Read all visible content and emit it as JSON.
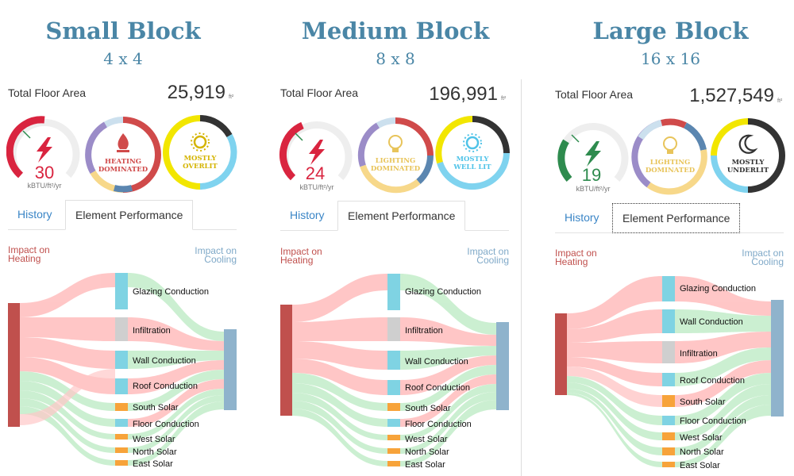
{
  "panels": [
    {
      "title": "Small Block",
      "subtitle": "4 x 4",
      "floor_area_label": "Total Floor Area",
      "floor_area_value": "25,919",
      "floor_area_unit": "ft²",
      "eui_value": "30",
      "eui_unit": "kBTU/ft²/yr",
      "eui_color": "#d9243f",
      "heating_label_line1": "HEATING",
      "heating_label_line2": "DOMINATED",
      "heating_color": "#d04a4a",
      "lighting_label_line1": "MOSTLY",
      "lighting_label_line2": "OVERLIT",
      "lighting_color": "#d4b400",
      "tabs": [
        "History",
        "Element Performance"
      ],
      "impact_heating": [
        "Impact on",
        "Heating"
      ],
      "impact_cooling": [
        "Impact on",
        "Cooling"
      ],
      "nodes": [
        "Glazing Conduction",
        "Infiltration",
        "Wall Conduction",
        "Roof Conduction",
        "South Solar",
        "Floor Conduction",
        "West Solar",
        "North Solar",
        "East Solar"
      ]
    },
    {
      "title": "Medium Block",
      "subtitle": "8 x 8",
      "floor_area_label": "Total Floor Area",
      "floor_area_value": "196,991",
      "floor_area_unit": "ft²",
      "eui_value": "24",
      "eui_unit": "kBTU/ft²/yr",
      "eui_color": "#d9243f",
      "heating_label_line1": "LIGHTING",
      "heating_label_line2": "DOMINATED",
      "heating_color": "#e8c45a",
      "lighting_label_line1": "MOSTLY",
      "lighting_label_line2": "WELL LIT",
      "lighting_color": "#4fc3e8",
      "tabs": [
        "History",
        "Element Performance"
      ],
      "impact_heating": [
        "Impact on",
        "Heating"
      ],
      "impact_cooling": [
        "Impact on",
        "Cooling"
      ],
      "nodes": [
        "Glazing Conduction",
        "Infiltration",
        "Wall Conduction",
        "Roof Conduction",
        "South Solar",
        "Floor Conduction",
        "West Solar",
        "North Solar",
        "East Solar"
      ]
    },
    {
      "title": "Large Block",
      "subtitle": "16 x 16",
      "floor_area_label": "Total Floor Area",
      "floor_area_value": "1,527,549",
      "floor_area_unit": "ft²",
      "eui_value": "19",
      "eui_unit": "kBTU/ft²/yr",
      "eui_color": "#2e8b4e",
      "heating_label_line1": "LIGHTING",
      "heating_label_line2": "DOMINATED",
      "heating_color": "#e8c45a",
      "lighting_label_line1": "MOSTLY",
      "lighting_label_line2": "UNDERLIT",
      "lighting_color": "#333333",
      "tabs": [
        "History",
        "Element Performance"
      ],
      "impact_heating": [
        "Impact on",
        "Heating"
      ],
      "impact_cooling": [
        "Impact on",
        "Cooling"
      ],
      "nodes": [
        "Glazing Conduction",
        "Wall Conduction",
        "Infiltration",
        "Roof Conduction",
        "South Solar",
        "Floor Conduction",
        "West Solar",
        "North Solar",
        "East Solar"
      ]
    }
  ],
  "colors": {
    "title": "#4a86a6",
    "heating_node": "#c0504d",
    "cooling_node": "#8fb3cc",
    "flow_heat": "#ffc4c4",
    "flow_cool": "#c9efcf",
    "node_blue": "#7fd3e3",
    "node_gray": "#cfcfcf",
    "node_orange": "#f7a33a",
    "tab_link": "#3a85c6"
  },
  "icons": [
    "lightning-icon",
    "flame-icon",
    "sun-icon",
    "bulb-icon",
    "moon-icon"
  ]
}
